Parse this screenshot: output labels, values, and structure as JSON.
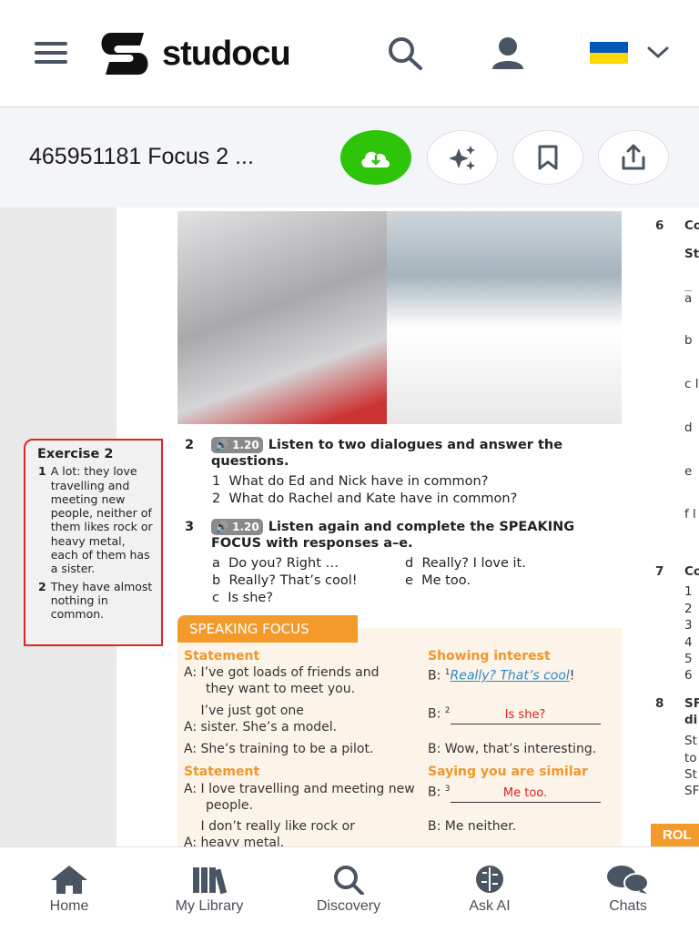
{
  "header": {
    "logo_text": "studocu",
    "brand_color": "#000000"
  },
  "docbar": {
    "title": "465951181 Focus 2 ...",
    "download_color": "#2ec40a"
  },
  "exercise_box": {
    "title": "Exercise 2",
    "items": [
      {
        "num": "1",
        "text": "A lot: they love travelling and meeting new people, neither of them likes rock or heavy metal, each of them has a sister."
      },
      {
        "num": "2",
        "text": "They have almost nothing in common."
      }
    ]
  },
  "q2": {
    "num": "2",
    "badge": "1.20",
    "text": "Listen to two dialogues and answer the questions.",
    "items": [
      {
        "num": "1",
        "text": "What do Ed and Nick have in common?"
      },
      {
        "num": "2",
        "text": "What do Rachel and Kate have in common?"
      }
    ]
  },
  "q3": {
    "num": "3",
    "badge": "1.20",
    "text": "Listen again and complete the SPEAKING FOCUS with responses a–e.",
    "options": [
      {
        "l": "a",
        "t": "Do you? Right …"
      },
      {
        "l": "b",
        "t": "Really? That’s cool!"
      },
      {
        "l": "c",
        "t": "Is she?"
      },
      {
        "l": "d",
        "t": "Really? I love it."
      },
      {
        "l": "e",
        "t": "Me too."
      }
    ]
  },
  "speaking_focus": {
    "title": "SPEAKING FOCUS",
    "h_statement1": "Statement",
    "h_interest": "Showing interest",
    "h_statement2": "Statement",
    "h_similar": "Saying you are similar",
    "a1": "I’ve got loads of friends and they want to meet you.",
    "b1_sup": "1",
    "b1": "Really? That’s cool",
    "b1_end": "!",
    "a2": "I’ve just got one sister. She’s a model.",
    "b2_sup": "2",
    "b2": "Is she?",
    "a3": "She’s training to be a pilot.",
    "b3": "Wow, that’s interesting.",
    "a4": "I love travelling and meeting new people.",
    "b4_sup": "3",
    "b4": "Me too.",
    "a5": "I don’t really like rock or heavy metal.",
    "b5": "Me neither.",
    "a_label": "A:",
    "b_label": "B:"
  },
  "right_column": {
    "q6": "6",
    "q6_text": "Co",
    "q6_sub": "St",
    "q6_items": [
      "a",
      "b",
      "c l",
      "d",
      "e",
      "f l"
    ],
    "q7": "7",
    "q7_text": "Co",
    "q7_items": [
      "1",
      "2",
      "3",
      "4",
      "5",
      "6"
    ],
    "q8": "8",
    "q8_text": "SF",
    "q8_lines": [
      "di",
      "St",
      "to",
      "St",
      "SF"
    ],
    "role_banner": "ROL"
  },
  "bottom_nav": [
    {
      "label": "Home"
    },
    {
      "label": "My Library"
    },
    {
      "label": "Discovery"
    },
    {
      "label": "Ask AI"
    },
    {
      "label": "Chats"
    }
  ]
}
